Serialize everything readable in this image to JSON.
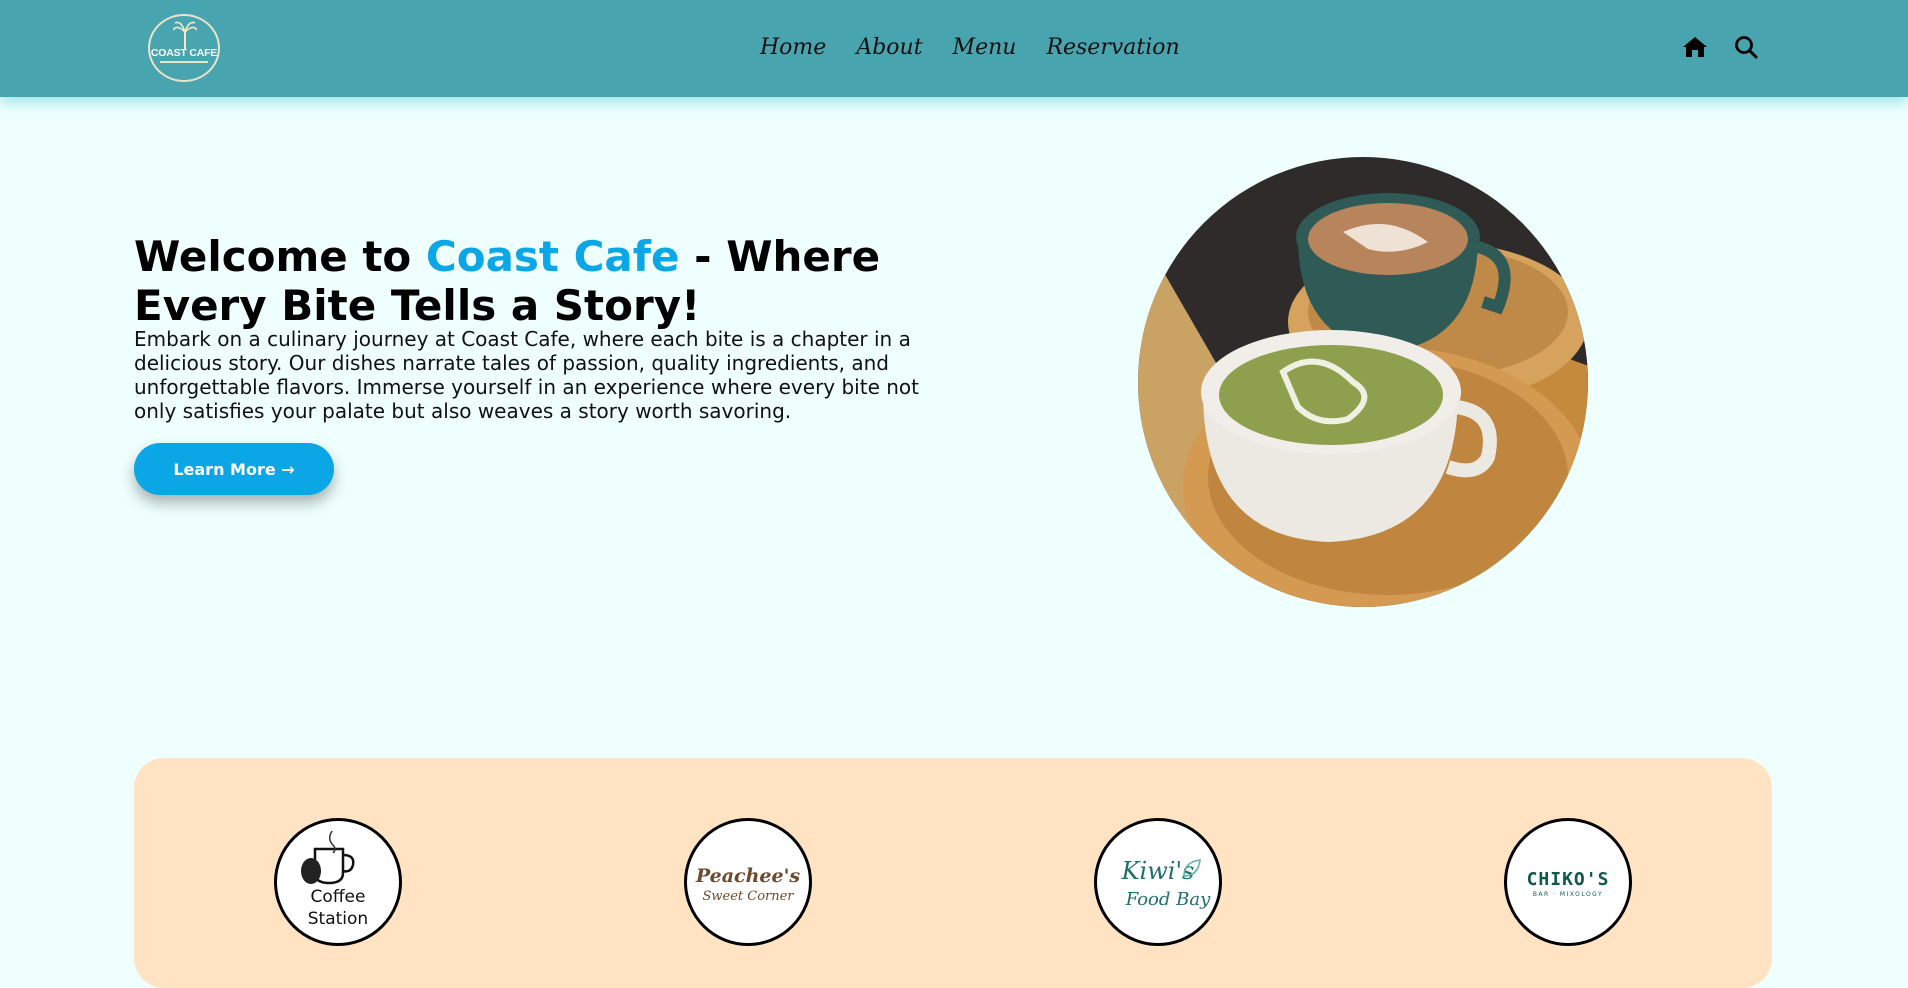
{
  "header": {
    "logo_text": "COAST CAFE",
    "nav": [
      "Home",
      "About",
      "Menu",
      "Reservation"
    ],
    "icons": [
      "home-icon",
      "search-icon"
    ]
  },
  "hero": {
    "title_prefix": "Welcome to ",
    "title_accent": "Coast Cafe",
    "title_suffix": " - Where Every Bite Tells a Story!",
    "body": "Embark on a culinary journey at Coast Cafe, where each bite is a chapter in a delicious story. Our dishes narrate tales of passion, quality ingredients, and unforgettable flavors. Immerse yourself in an experience where every bite not only satisfies your palate but also weaves a story worth savoring.",
    "button_label": "Learn More →"
  },
  "brands": [
    {
      "line1": "Coffee",
      "line2": "Station"
    },
    {
      "line1": "Peachee's",
      "line2": "Sweet Corner"
    },
    {
      "line1": "Kiwi's",
      "line2": "Food Bay"
    },
    {
      "line1": "CHIKO'S",
      "line2": "BAR · MIXOLOGY"
    }
  ],
  "colors": {
    "header_bg": "#48a5b0",
    "page_bg": "#effffe",
    "accent": "#0aa6e6",
    "brands_bg": "#ffe3c2"
  }
}
